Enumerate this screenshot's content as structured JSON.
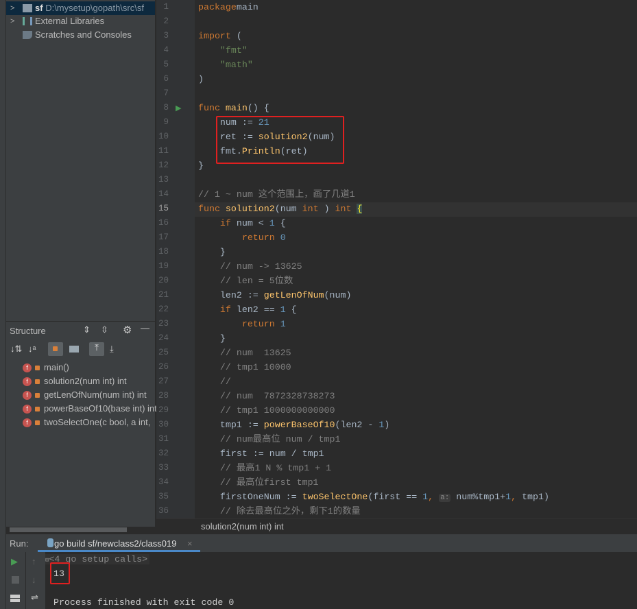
{
  "project": {
    "items": [
      {
        "label": "sf",
        "path": "D:\\mysetup\\gopath\\src\\sf",
        "icon": "folder-icon"
      },
      {
        "label": "External Libraries",
        "icon": "library-icon"
      },
      {
        "label": "Scratches and Consoles",
        "icon": "scratches-icon"
      }
    ]
  },
  "structure": {
    "title": "Structure",
    "items": [
      "main()",
      "solution2(num int) int",
      "getLenOfNum(num int) int",
      "powerBaseOf10(base int) int",
      "twoSelectOne(c bool, a int,"
    ]
  },
  "editor": {
    "current_line": 15,
    "lines": [
      [
        [
          "kw",
          "package"
        ],
        [
          "",
          "main"
        ]
      ],
      [],
      [
        [
          "kw",
          "import"
        ],
        [
          "",
          " ("
        ]
      ],
      [
        [
          "",
          "    "
        ],
        [
          "str",
          "\"fmt\""
        ]
      ],
      [
        [
          "",
          "    "
        ],
        [
          "str",
          "\"math\""
        ]
      ],
      [
        [
          "",
          ")"
        ]
      ],
      [],
      [
        [
          "kw",
          "func "
        ],
        [
          "fn",
          "main"
        ],
        [
          "",
          "() {"
        ]
      ],
      [
        [
          "",
          "    num := "
        ],
        [
          "num",
          "21"
        ]
      ],
      [
        [
          "",
          "    ret := "
        ],
        [
          "fn",
          "solution2"
        ],
        [
          "",
          "(num)"
        ]
      ],
      [
        [
          "",
          "    fmt."
        ],
        [
          "fn",
          "Println"
        ],
        [
          "",
          "(ret)"
        ]
      ],
      [
        [
          "",
          "}"
        ]
      ],
      [],
      [
        [
          "cm",
          "// 1 ~ num 这个范围上，画了几道1"
        ]
      ],
      [
        [
          "kw",
          "func "
        ],
        [
          "fn",
          "solution2"
        ],
        [
          "",
          "(num "
        ],
        [
          "kw",
          "int"
        ],
        [
          "",
          " ) "
        ],
        [
          "kw",
          "int "
        ],
        [
          "brace",
          "{"
        ]
      ],
      [
        [
          "",
          "    "
        ],
        [
          "kw",
          "if"
        ],
        [
          "",
          " num < "
        ],
        [
          "num",
          "1"
        ],
        [
          "",
          " {"
        ]
      ],
      [
        [
          "",
          "        "
        ],
        [
          "kw",
          "return "
        ],
        [
          "num",
          "0"
        ]
      ],
      [
        [
          "",
          "    }"
        ]
      ],
      [
        [
          "cm",
          "    // num -> 13625"
        ]
      ],
      [
        [
          "cm",
          "    // len = 5位数"
        ]
      ],
      [
        [
          "",
          "    len2 := "
        ],
        [
          "fn",
          "getLenOfNum"
        ],
        [
          "",
          "(num)"
        ]
      ],
      [
        [
          "",
          "    "
        ],
        [
          "kw",
          "if"
        ],
        [
          "",
          " len2 == "
        ],
        [
          "num",
          "1"
        ],
        [
          "",
          " {"
        ]
      ],
      [
        [
          "",
          "        "
        ],
        [
          "kw",
          "return "
        ],
        [
          "num",
          "1"
        ]
      ],
      [
        [
          "",
          "    }"
        ]
      ],
      [
        [
          "cm",
          "    // num  13625"
        ]
      ],
      [
        [
          "cm",
          "    // tmp1 10000"
        ]
      ],
      [
        [
          "cm",
          "    //"
        ]
      ],
      [
        [
          "cm",
          "    // num  7872328738273"
        ]
      ],
      [
        [
          "cm",
          "    // tmp1 1000000000000"
        ]
      ],
      [
        [
          "",
          "    tmp1 := "
        ],
        [
          "fn",
          "powerBaseOf10"
        ],
        [
          "",
          "(len2 - "
        ],
        [
          "num",
          "1"
        ],
        [
          "",
          ")"
        ]
      ],
      [
        [
          "cm",
          "    // num最高位 num / tmp1"
        ]
      ],
      [
        [
          "",
          "    first := num / tmp1"
        ]
      ],
      [
        [
          "cm",
          "    // 最高1 N % tmp1 + 1"
        ]
      ],
      [
        [
          "cm",
          "    // 最高位first tmp1"
        ]
      ],
      [
        [
          "",
          "    firstOneNum := "
        ],
        [
          "fn",
          "twoSelectOne"
        ],
        [
          "",
          "(first == "
        ],
        [
          "num",
          "1"
        ],
        [
          "kw",
          ", "
        ],
        [
          "hint",
          "a:"
        ],
        [
          "",
          " num%tmp1+"
        ],
        [
          "num",
          "1"
        ],
        [
          "kw",
          ", "
        ],
        [
          "",
          "tmp1)"
        ]
      ],
      [
        [
          "cm",
          "    // 除去最高位之外，剩下1的数量"
        ]
      ]
    ]
  },
  "breadcrumb": "solution2(num int) int",
  "run": {
    "label": "Run:",
    "tab": "go build sf/newclass2/class019",
    "setup_calls": "<4 go setup calls>",
    "output": "13",
    "finished": "Process finished with exit code 0"
  },
  "colors": {
    "keyword": "#cc7832",
    "function": "#ffc66d",
    "number": "#6897bb",
    "string": "#6a8759",
    "comment": "#808080",
    "highlight_box": "#e02020"
  }
}
